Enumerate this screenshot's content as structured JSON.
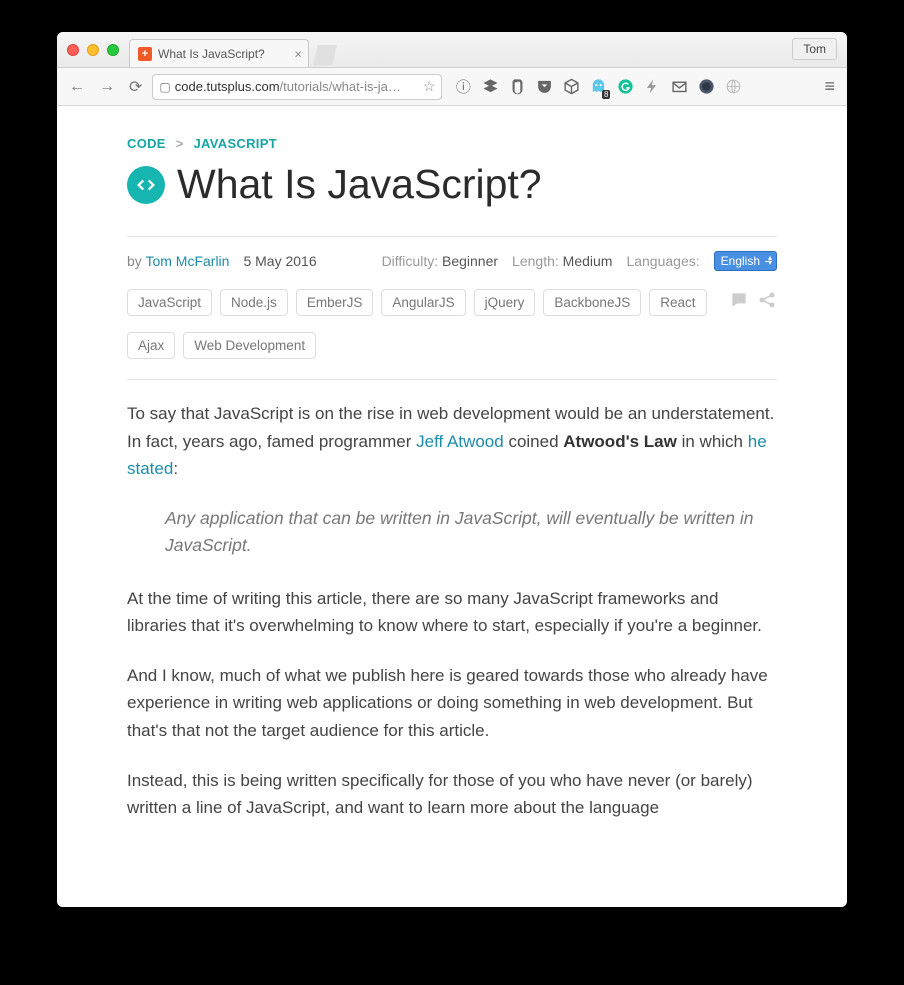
{
  "window": {
    "tab_title": "What Is JavaScript?",
    "user_button": "Tom"
  },
  "toolbar": {
    "url_host": "code.tutsplus.com",
    "url_path": "/tutorials/what-is-ja…"
  },
  "crumbs": {
    "root": "CODE",
    "section": "JAVASCRIPT",
    "sep": ">"
  },
  "article": {
    "title": "What Is JavaScript?",
    "by_label": "by",
    "author": "Tom McFarlin",
    "date": "5 May 2016",
    "difficulty_label": "Difficulty:",
    "difficulty_value": "Beginner",
    "length_label": "Length:",
    "length_value": "Medium",
    "languages_label": "Languages:",
    "language_selected": "English"
  },
  "tags": [
    "JavaScript",
    "Node.js",
    "EmberJS",
    "AngularJS",
    "jQuery",
    "BackboneJS",
    "React",
    "Ajax",
    "Web Development"
  ],
  "body": {
    "p1a": "To say that JavaScript is on the rise in web development would be an understatement. In fact, years ago, famed programmer ",
    "p1_link1": "Jeff Atwood",
    "p1b": " coined ",
    "p1_bold": "Atwood's Law",
    "p1c": " in which ",
    "p1_link2": "he stated",
    "p1d": ":",
    "quote": "Any application that can be written in JavaScript, will eventually be written in JavaScript.",
    "p2": "At the time of writing this article, there are so many JavaScript frameworks and libraries that it's overwhelming to know where to start, especially if you're a beginner.",
    "p3": "And I know, much of what we publish here is geared towards those who already have experience in writing web applications or doing something in web development. But that's that not the target audience for this article.",
    "p4": "Instead, this is being written specifically for those of you who have never (or barely) written a line of JavaScript, and want to learn more about the language"
  }
}
